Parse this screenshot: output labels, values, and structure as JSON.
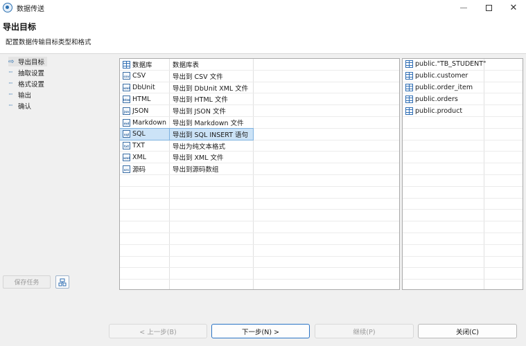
{
  "window": {
    "title": "数据传送",
    "icon": "app-icon"
  },
  "header": {
    "title": "导出目标",
    "subtitle": "配置数据传输目标类型和格式"
  },
  "nav": {
    "items": [
      {
        "label": "导出目标",
        "current": true
      },
      {
        "label": "抽取设置"
      },
      {
        "label": "格式设置"
      },
      {
        "label": "输出"
      },
      {
        "label": "确认"
      }
    ],
    "save_task_label": "保存任务",
    "tool_button_icon": "config-icon"
  },
  "formats": [
    {
      "name": "数据库",
      "desc": "数据库表",
      "icon": "table-icon",
      "badge": ""
    },
    {
      "name": "CSV",
      "desc": "导出到 CSV 文件",
      "icon": "csv-file-icon",
      "badge": "csv"
    },
    {
      "name": "DbUnit",
      "desc": "导出到 DbUnit XML 文件",
      "icon": "xml-file-icon",
      "badge": "xml"
    },
    {
      "name": "HTML",
      "desc": "导出到 HTML 文件",
      "icon": "html-file-icon",
      "badge": "htm"
    },
    {
      "name": "JSON",
      "desc": "导出到 JSON 文件",
      "icon": "json-file-icon",
      "badge": "jsn"
    },
    {
      "name": "Markdown",
      "desc": "导出到 Markdown 文件",
      "icon": "markdown-file-icon",
      "badge": "md"
    },
    {
      "name": "SQL",
      "desc": "导出到 SQL INSERT 语句",
      "icon": "sql-file-icon",
      "badge": "sql",
      "selected": true
    },
    {
      "name": "TXT",
      "desc": "导出为纯文本格式",
      "icon": "txt-file-icon",
      "badge": "txt"
    },
    {
      "name": "XML",
      "desc": "导出到 XML 文件",
      "icon": "xml-file-icon",
      "badge": "xml"
    },
    {
      "name": "源码",
      "desc": "导出到源码数组",
      "icon": "source-file-icon",
      "badge": "src"
    }
  ],
  "tables": [
    "public.\"TB_STUDENT\"",
    "public.customer",
    "public.order_item",
    "public.orders",
    "public.product"
  ],
  "buttons": {
    "prev": "< 上一步(B)",
    "next": "下一步(N) >",
    "continue": "继续(P)",
    "close": "关闭(C)"
  },
  "colors": {
    "accent": "#2a73c5",
    "selection": "#cce3f7"
  }
}
